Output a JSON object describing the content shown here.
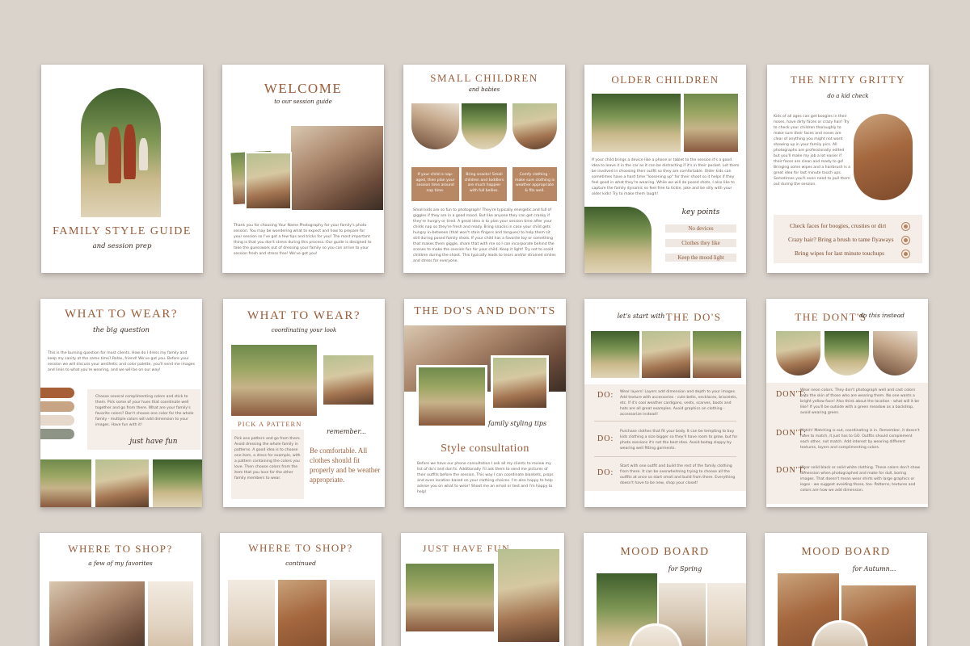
{
  "pages": {
    "cover": {
      "title": "FAMILY STYLE GUIDE",
      "subtitle": "and session prep"
    },
    "welcome": {
      "title": "WELCOME",
      "subtitle": "to our session guide",
      "body": "Thank you for choosing Your Name Photography for your family's photo session. You may be wondering what to expect and how to prepare for your session so I've got a few tips and tricks for you! The most important thing is that you don't stress during this process. Our guide is designed to take the guesswork out of dressing your family so you can arrive to your session fresh and stress free! We've got you!"
    },
    "small_children": {
      "title": "SMALL CHILDREN",
      "subtitle": "and babies",
      "tips": [
        "If your child is nap-aged, then plan your session time around nap time.",
        "Bring snacks! Small children and toddlers are much happier with full bellies.",
        "Comfy clothing - make sure clothing is weather appropriate & fits well."
      ],
      "body": "Small kids are so fun to photograph! They're typically energetic and full of giggles if they are in a good mood. But like anyone they can get cranky if they're hungry or tired. A great idea is to plan your session time after your childs nap so they're fresh and ready. Bring snacks in case your child gets hungry in-between (that won't stain fingers and tongues) to help them sit still during posed family shots. If your child has a favorite toy or something that makes them giggle, share that with me so I can incorporate behind the scenes to make the session fun for your child. Keep it light! Try not to scold children during the shoot. This typically leads to tears and/or strained smiles and stress for everyone."
    },
    "older_children": {
      "title": "OLDER CHILDREN",
      "body": "If your child brings a device like a phone or tablet to the session it's a good idea to leave it in the car as it can be distracting if it's in their pocket. Let them be involved in choosing their outfit so they are comfortable. Older kids can sometimes have a hard time \"loosening up\" for their shoot so it helps if they feel good in what they're wearing. While we will do posed shots, I also like to capture the family dynamic so feel free to tickle, joke and be silly with your older kids! Try to make them laugh!",
      "key_points_label": "key points",
      "key_points": [
        "No devices",
        "Clothes they like",
        "Keep the mood light"
      ]
    },
    "nitty_gritty": {
      "title": "THE NITTY GRITTY",
      "subtitle": "do a kid check",
      "body": "Kids of all ages can get boogies in their noses, have dirty faces or crazy hair! Try to check your children thoroughly to make sure their faces and noses are clear of anything you might not want showing up in your family pics. All photographs are professionally edited but you'll make my job a lot easier if their faces are clean and ready to go! Bringing some wipes and a hairbrush is a great idea for last minute touch ups. Sometimes you'll even need to pull them out during the session.",
      "checks": [
        "Check faces for boogies, crusties or dirt",
        "Crazy hair? Bring a brush to tame flyaways",
        "Bring wipes for last minute touchups"
      ]
    },
    "what_to_wear": {
      "title": "WHAT TO WEAR?",
      "subtitle": "the big question",
      "body": "This is the burning question for most clients. How do I dress my family and keep my sanity at the same time? Relax, friend! We've got you. Before your session we will discuss your aesthetic and color palette, you'll send me images and links to what you're wearing, and we will be on our way!",
      "swatches": [
        "#a65f36",
        "#c7a584",
        "#e6d9cb",
        "#8e9486"
      ],
      "palette_text": "Choose several complimenting colors and stick to them. Pick some of your hues that coordinate well together and go from there. What are your family's favorite colors? Don't choose one color for the whole family - multiple colors will add dimension to your images. Have fun with it!",
      "script": "just have fun"
    },
    "what_to_wear_2": {
      "title": "WHAT TO WEAR?",
      "subtitle": "coordinating your look",
      "pattern_label": "PICK A PATTERN",
      "pattern_text": "Pick one pattern and go from there. Avoid dressing the whole family in patterns. A good idea is to choose one item, a dress for example, with a pattern containing the colors you love. Then choose colors from the item that you love for the other family members to wear.",
      "remember_label": "remember...",
      "remember_text": "Be comfortable. All clothes should fit properly and be weather appropriate."
    },
    "dos_donts": {
      "title": "THE DO'S AND DON'TS",
      "script": "family styling tips",
      "heading": "Style consultation",
      "body": "Before we have our phone consultation I ask all my clients to review my list of do's and don'ts. Additionally I'll ask them to send me pictures of their outfits before the session. This way I can coordinate blankets, props and even location based on your clothing choices. I'm also happy to help advise you on what to wear! Shoot me an email or text and I'm happy to help!"
    },
    "the_dos": {
      "script": "let's start with",
      "title": "THE DO'S",
      "items": [
        {
          "label": "DO:",
          "text": "Wear layers! Layers add dimension and depth to your images. Add texture with accessories - cute belts, necklaces, bracelets, etc. If it's cool weather cardigans, vests, scarves, boots and hats are all great examples. Avoid graphics on clothing - accessorize instead!"
        },
        {
          "label": "DO:",
          "text": "Purchase clothes that fit your body. It can be tempting to buy kids clothing a size bigger so they'll have room to grow, but for photo sessions it's not the best idea. Avoid bodag sloppy by wearing well fitting garments."
        },
        {
          "label": "DO:",
          "text": "Start with one outfit and build the rest of the family clothing from there. It can be overwhelming trying to choose all the outfits at once so start small and build from there. Everything doesn't have to be new, shop your closet!"
        }
      ]
    },
    "the_donts": {
      "title": "THE DONT'S",
      "script": "do this instead",
      "items": [
        {
          "label": "DON'T:",
          "text": "Wear neon colors. They don't photograph well and cast colors onto the skin of those who are wearing them. No one wants a bright yellow face! Also think about the location - what will it be like? If you'll be outside with a green meadow as a backdrop, avoid wearing green."
        },
        {
          "label": "DON'T:",
          "text": "Match! Matching is out, coordinating is in. Remember, it doesn't have to match, it just has to GO. Outfits should complement each other, not match. Add interest by wearing different textures, layers and complimenting colors."
        },
        {
          "label": "DON'T:",
          "text": "Wear solid black or solid white clothing. These colors don't show dimension when photographed and make for dull, boring images. That doesn't mean wear shirts with large graphics or logos - we suggest avoiding those, too. Patterns, textures and colors are how we add dimension."
        }
      ]
    },
    "where_to_shop": {
      "title": "WHERE TO SHOP?",
      "subtitle": "a few of my favorites"
    },
    "where_to_shop_2": {
      "title": "WHERE TO SHOP?",
      "subtitle": "continued"
    },
    "just_have_fun": {
      "title": "JUST HAVE FUN"
    },
    "mood_spring": {
      "title": "MOOD BOARD",
      "subtitle": "for Spring"
    },
    "mood_autumn": {
      "title": "MOOD BOARD",
      "subtitle": "for Autumn..."
    }
  },
  "colors": {
    "background": "#d9d3cc",
    "accent": "#9a5b37",
    "tan": "#b88865",
    "cream": "#f4ede8"
  }
}
